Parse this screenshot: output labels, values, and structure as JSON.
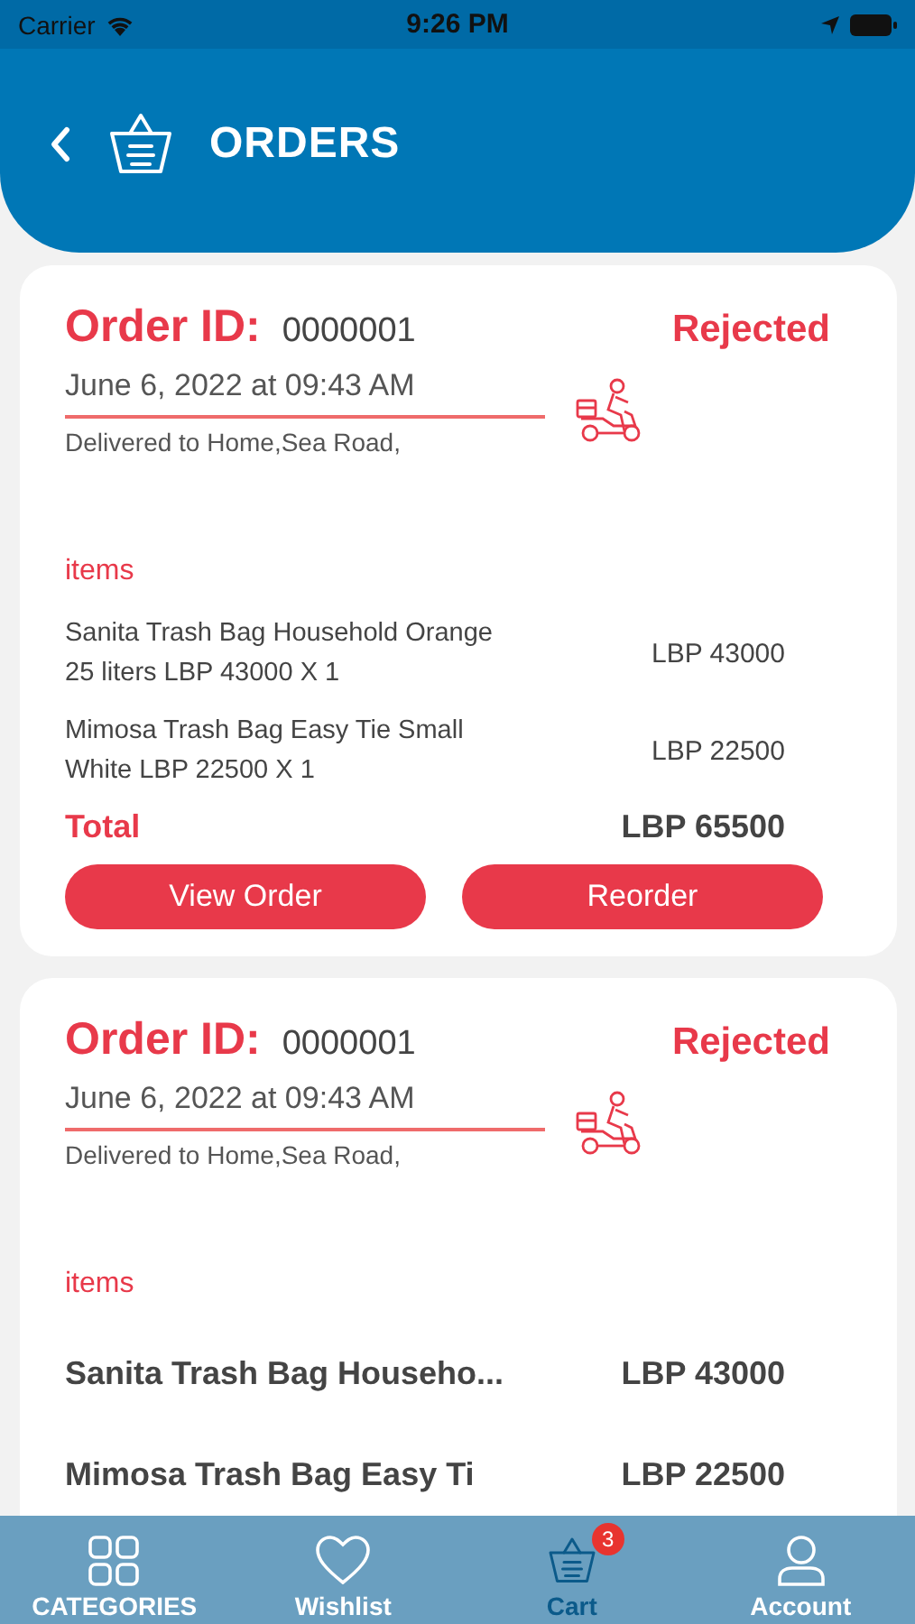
{
  "status_bar": {
    "carrier": "Carrier",
    "time": "9:26 PM"
  },
  "header": {
    "title": "ORDERS"
  },
  "orders": [
    {
      "id_label": "Order ID:",
      "id": "0000001",
      "status": "Rejected",
      "date": "June 6, 2022 at 09:43 AM",
      "address": "Delivered to Home,Sea Road,",
      "items_label": "items",
      "items": [
        {
          "kind": "detailed",
          "name": "Sanita Trash Bag Household Orange 25 liters LBP  43000 X 1",
          "price": "LBP 43000"
        },
        {
          "kind": "detailed",
          "name": "Mimosa Trash Bag Easy Tie Small White LBP  22500 X 1",
          "price": "LBP 22500"
        }
      ],
      "total_label": "Total",
      "total": "LBP 65500",
      "buttons": [
        "View Order",
        "Reorder"
      ]
    },
    {
      "id_label": "Order ID:",
      "id": "0000001",
      "status": "Rejected",
      "date": "June 6, 2022 at 09:43 AM",
      "address": "Delivered to Home,Sea Road,",
      "items_label": "items",
      "items": [
        {
          "kind": "summary",
          "name": "Sanita Trash Bag Househo...",
          "price": "LBP 43000"
        },
        {
          "kind": "summary",
          "name": "Mimosa Trash Bag Easy Ti",
          "price": "LBP 22500"
        }
      ]
    }
  ],
  "tab_bar": [
    {
      "label": "CATEGORIES",
      "selected": false
    },
    {
      "label": "Wishlist",
      "selected": false
    },
    {
      "label": "Cart",
      "selected": true,
      "badge": "3"
    },
    {
      "label": "Account",
      "selected": false
    }
  ]
}
